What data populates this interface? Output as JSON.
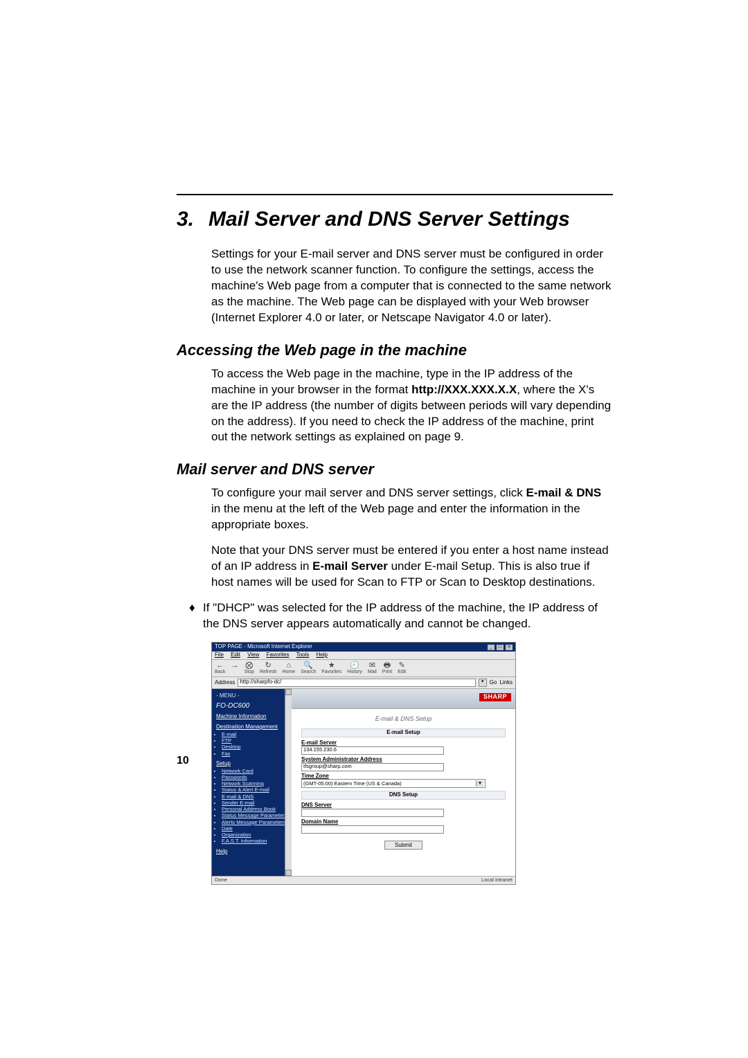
{
  "chapter": {
    "number": "3.",
    "title": "Mail Server and DNS Server Settings"
  },
  "intro": "Settings for your E-mail server and DNS server must be configured in order to use the network scanner function. To configure the settings, access the machine's Web page from a computer that is connected to the same network as the machine. The Web page can be displayed with your Web browser (Internet Explorer 4.0 or later, or Netscape Navigator 4.0 or later).",
  "section1": {
    "heading": "Accessing the Web page in the machine"
  },
  "section1_para_a": "To access the Web page in the machine, type in the IP address of the machine in your browser in the format ",
  "section1_para_b": "http://XXX.XXX.X.X",
  "section1_para_c": ", where the X's are the IP address (the number of digits between periods will vary depending on the address). If you need to check the IP address of the machine, print out the network settings as explained on page 9.",
  "section2": {
    "heading": "Mail server and DNS server"
  },
  "section2_para1_a": "To configure your mail server and DNS server settings, click ",
  "section2_para1_b": "E-mail & DNS",
  "section2_para1_c": " in the menu at the left of the Web page and enter the information in the appropriate boxes.",
  "section2_para2_a": "Note that your DNS server must be entered if you enter a host name instead of an IP address in ",
  "section2_para2_b": "E-mail Server",
  "section2_para2_c": " under E-mail Setup. This is also true if host names will be used for Scan to FTP or Scan to Desktop destinations.",
  "bullet1": "If \"DHCP\" was selected for the IP address of the machine, the IP address of the DNS server appears automatically and cannot be changed.",
  "page_number": "10",
  "screenshot": {
    "window_title": "TOP PAGE - Microsoft Internet Explorer",
    "menubar": [
      "File",
      "Edit",
      "View",
      "Favorites",
      "Tools",
      "Help"
    ],
    "toolbar": [
      {
        "icon": "←",
        "label": "Back"
      },
      {
        "icon": "→",
        "label": ""
      },
      {
        "icon": "⨂",
        "label": "Stop"
      },
      {
        "icon": "↻",
        "label": "Refresh"
      },
      {
        "icon": "⌂",
        "label": "Home"
      },
      {
        "icon": "🔍",
        "label": "Search"
      },
      {
        "icon": "★",
        "label": "Favorites"
      },
      {
        "icon": "🕘",
        "label": "History"
      },
      {
        "icon": "✉",
        "label": "Mail"
      },
      {
        "icon": "🖶",
        "label": "Print"
      },
      {
        "icon": "✎",
        "label": "Edit"
      }
    ],
    "address_label": "Address",
    "address_value": "http://sharpfo-dc/",
    "go_label": "Go",
    "links_label": "Links",
    "sidebar": {
      "menu_label": "- MENU -",
      "model": "FO-DC600",
      "h1": "Machine Information",
      "h2": "Destination Management",
      "dest_items": [
        "E-mail",
        "FTP",
        "Desktop",
        "Fax"
      ],
      "h3": "Setup",
      "setup_items": [
        "Network Card",
        "Passwords",
        "Network Scanning",
        "Status & Alert E-mail",
        "E-mail & DNS",
        "Sender E-mail",
        "Personal Address Book",
        "Status Message Parameters",
        "Alerts Message Parameters",
        "Date",
        "Organization",
        "F.A.S.T. Information"
      ],
      "help": "Help"
    },
    "main": {
      "brand": "SHARP",
      "page_title": "E-mail & DNS Setup",
      "sec_email": "E-mail Setup",
      "lbl_email_server": "E-mail Server",
      "val_email_server": "134.155.230.6",
      "lbl_admin": "System Administrator Address",
      "val_admin": "tfsgroup@sharp.com",
      "lbl_tz": "Time Zone",
      "val_tz": "(GMT-05:00) Eastern Time (US & Canada)",
      "sec_dns": "DNS Setup",
      "lbl_dns": "DNS Server",
      "val_dns": "",
      "lbl_domain": "Domain Name",
      "val_domain": "",
      "submit": "Submit"
    },
    "status_left": "Done",
    "status_right": "Local intranet"
  }
}
